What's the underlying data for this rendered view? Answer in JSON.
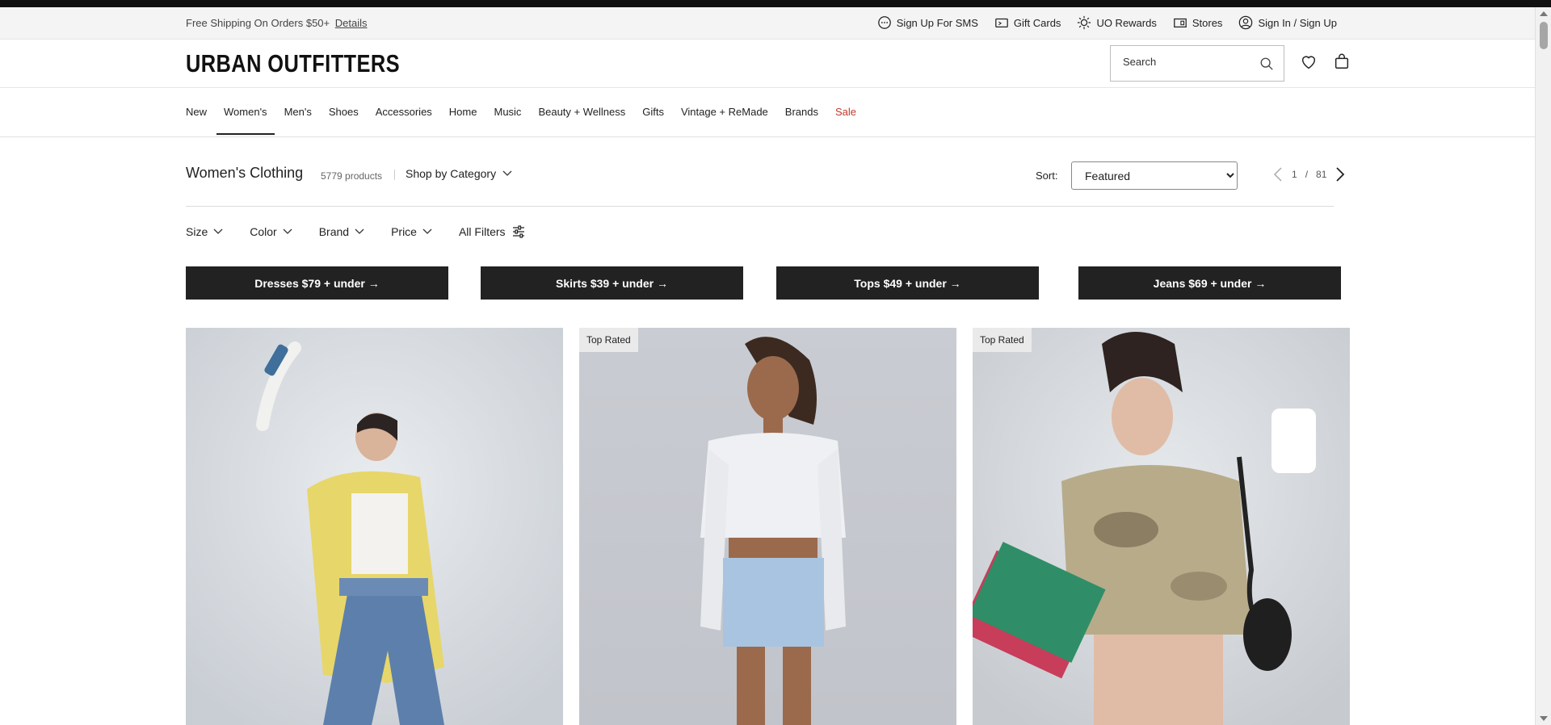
{
  "utility": {
    "shipping_text": "Free Shipping On Orders $50+",
    "details_link": "Details",
    "items": [
      {
        "label": "Sign Up For SMS",
        "icon": "chat-icon"
      },
      {
        "label": "Gift Cards",
        "icon": "gift-card-icon"
      },
      {
        "label": "UO Rewards",
        "icon": "rewards-icon"
      },
      {
        "label": "Stores",
        "icon": "store-icon"
      },
      {
        "label": "Sign In / Sign Up",
        "icon": "user-icon"
      }
    ]
  },
  "header": {
    "logo": "URBAN OUTFITTERS",
    "search_placeholder": "Search",
    "icons": [
      "search-icon",
      "heart-icon",
      "bag-icon"
    ]
  },
  "nav": {
    "items": [
      "New",
      "Women's",
      "Men's",
      "Shoes",
      "Accessories",
      "Home",
      "Music",
      "Beauty + Wellness",
      "Gifts",
      "Vintage + ReMade",
      "Brands",
      "Sale"
    ],
    "active": "Women's",
    "sale_color": "#c0392b"
  },
  "plp": {
    "title": "Women's Clothing",
    "count": "5779 products",
    "shop_by": "Shop by Category",
    "sort_label": "Sort:",
    "sort_value": "Featured",
    "page_current": "1",
    "page_sep": "/",
    "page_total": "81"
  },
  "filters": [
    "Size",
    "Color",
    "Brand",
    "Price",
    "All Filters"
  ],
  "promos": [
    "Dresses $79 + under →",
    "Skirts $39 + under →",
    "Tops $49 + under →",
    "Jeans $69 + under →"
  ],
  "products": [
    {
      "badge": ""
    },
    {
      "badge": "Top Rated"
    },
    {
      "badge": "Top Rated"
    }
  ],
  "colors": {
    "promo_bg": "#222222",
    "badge_bg": "#eaeaea"
  }
}
